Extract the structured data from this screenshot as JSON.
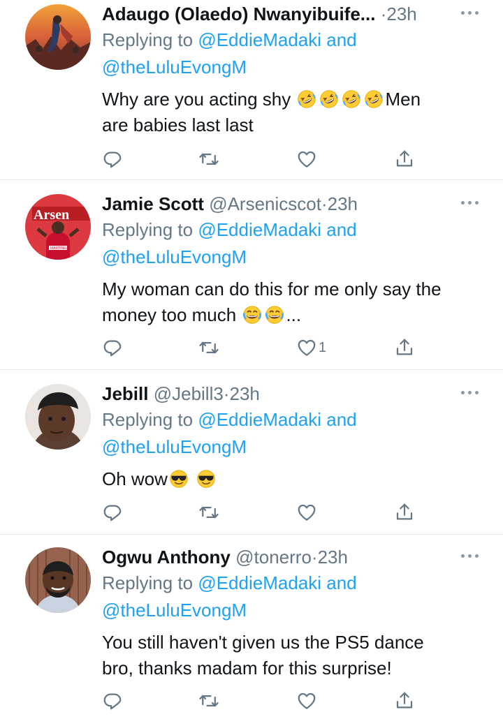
{
  "icons": {
    "reply": "reply-icon",
    "retweet": "retweet-icon",
    "like": "heart-icon",
    "share": "share-icon",
    "more": "more-options-icon"
  },
  "colors": {
    "text": "#0f1419",
    "secondary": "#657786",
    "link": "#1da1f2",
    "divider": "#e1e8ed"
  },
  "tweets": [
    {
      "name": "Adaugo (Olaedo) Nwanyibuife...",
      "handle": "",
      "sep": "·",
      "time": "23h",
      "replying_prefix": "Replying to ",
      "mention1": "@EddieMadaki",
      "and": " and",
      "mention2": "@theLuluEvongM",
      "text_a": "Why are you acting shy",
      "emojis": [
        "rolling-on-floor-laughing",
        "rolling-on-floor-laughing",
        "rolling-on-floor-laughing",
        "rolling-on-floor-laughing"
      ],
      "text_b": "Men",
      "text_line2": "are babies last last",
      "likes": ""
    },
    {
      "name": "Jamie Scott",
      "handle": "@Arsenicscot",
      "sep": "·",
      "time": "23h",
      "replying_prefix": "Replying to ",
      "mention1": "@EddieMadaki",
      "and": " and",
      "mention2": "@theLuluEvongM",
      "text_line1": "My woman can do this for me only say the",
      "text_a": "money too much",
      "emojis": [
        "face-with-tears-of-joy",
        "face-with-tears-of-joy"
      ],
      "text_b": "...",
      "likes": "1",
      "avatar_text": "Arsen",
      "avatar_shirt": "MARTINELLI"
    },
    {
      "name": "Jebill",
      "handle": "@Jebill3",
      "sep": "·",
      "time": "23h",
      "replying_prefix": "Replying to ",
      "mention1": "@EddieMadaki",
      "and": " and",
      "mention2": "@theLuluEvongM",
      "text_a": "Oh wow",
      "emojis": [
        "smiling-face-with-sunglasses",
        "smiling-face-with-sunglasses"
      ],
      "likes": ""
    },
    {
      "name": "Ogwu Anthony",
      "handle": "@tonerro",
      "sep": "·",
      "time": "23h",
      "replying_prefix": "Replying to ",
      "mention1": "@EddieMadaki",
      "and": " and",
      "mention2": "@theLuluEvongM",
      "text_line1": "You still haven't given us the PS5 dance",
      "text_line2": "bro, thanks madam for this surprise!",
      "likes": ""
    }
  ]
}
